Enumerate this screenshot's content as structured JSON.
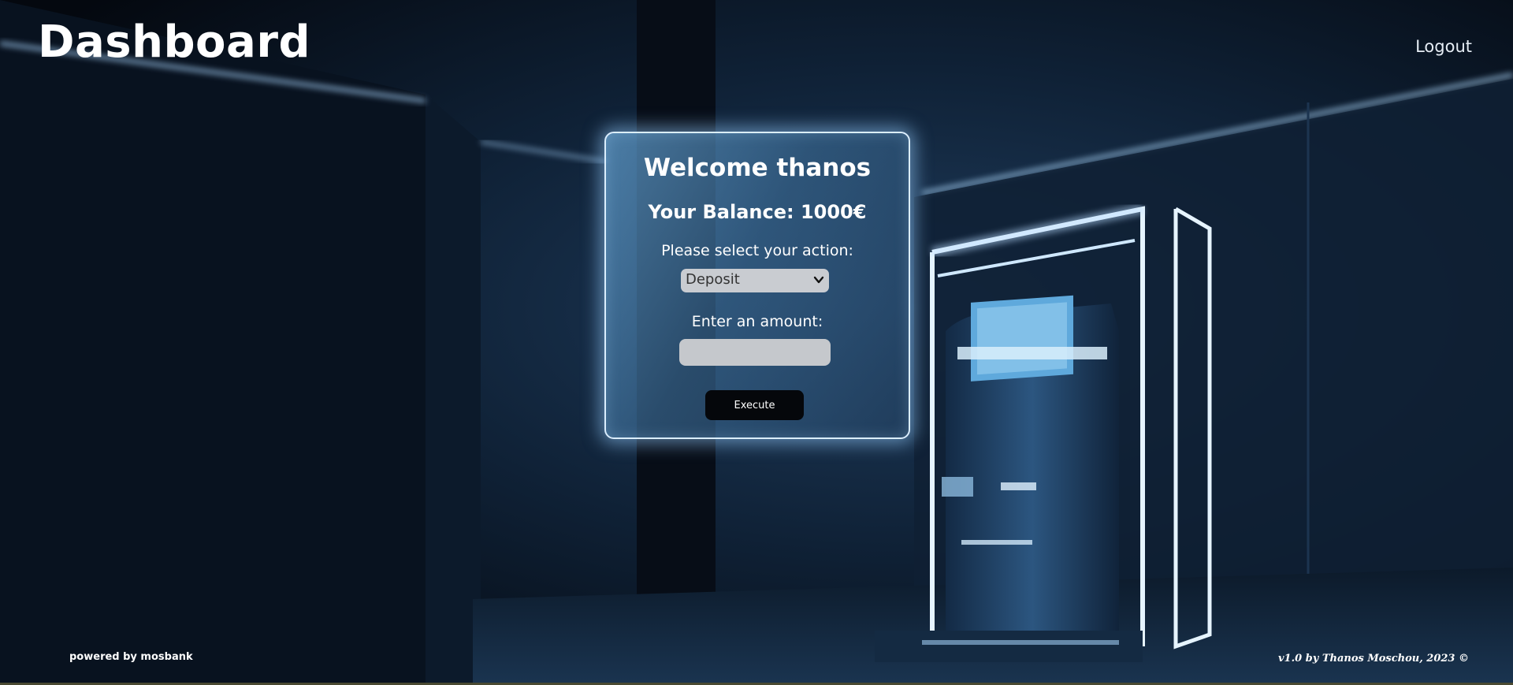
{
  "header": {
    "title": "Dashboard",
    "logout_label": "Logout"
  },
  "card": {
    "welcome": "Welcome thanos",
    "balance_label": "Your Balance:",
    "balance_value": "1000€",
    "action_label": "Please select your action:",
    "action_selected": "Deposit",
    "amount_label": "Enter an amount:",
    "amount_value": "",
    "execute_label": "Execute"
  },
  "footer": {
    "powered": "powered by mosbank",
    "version": "v1.0 by Thanos Moschou, 2023 ©"
  },
  "icons": {
    "select_chevron": "chevron-down-icon"
  },
  "colors": {
    "card_border": "#dbeeff",
    "card_glow": "#96cdff",
    "button_bg": "#05070b",
    "input_bg": "#c5c8cc"
  }
}
